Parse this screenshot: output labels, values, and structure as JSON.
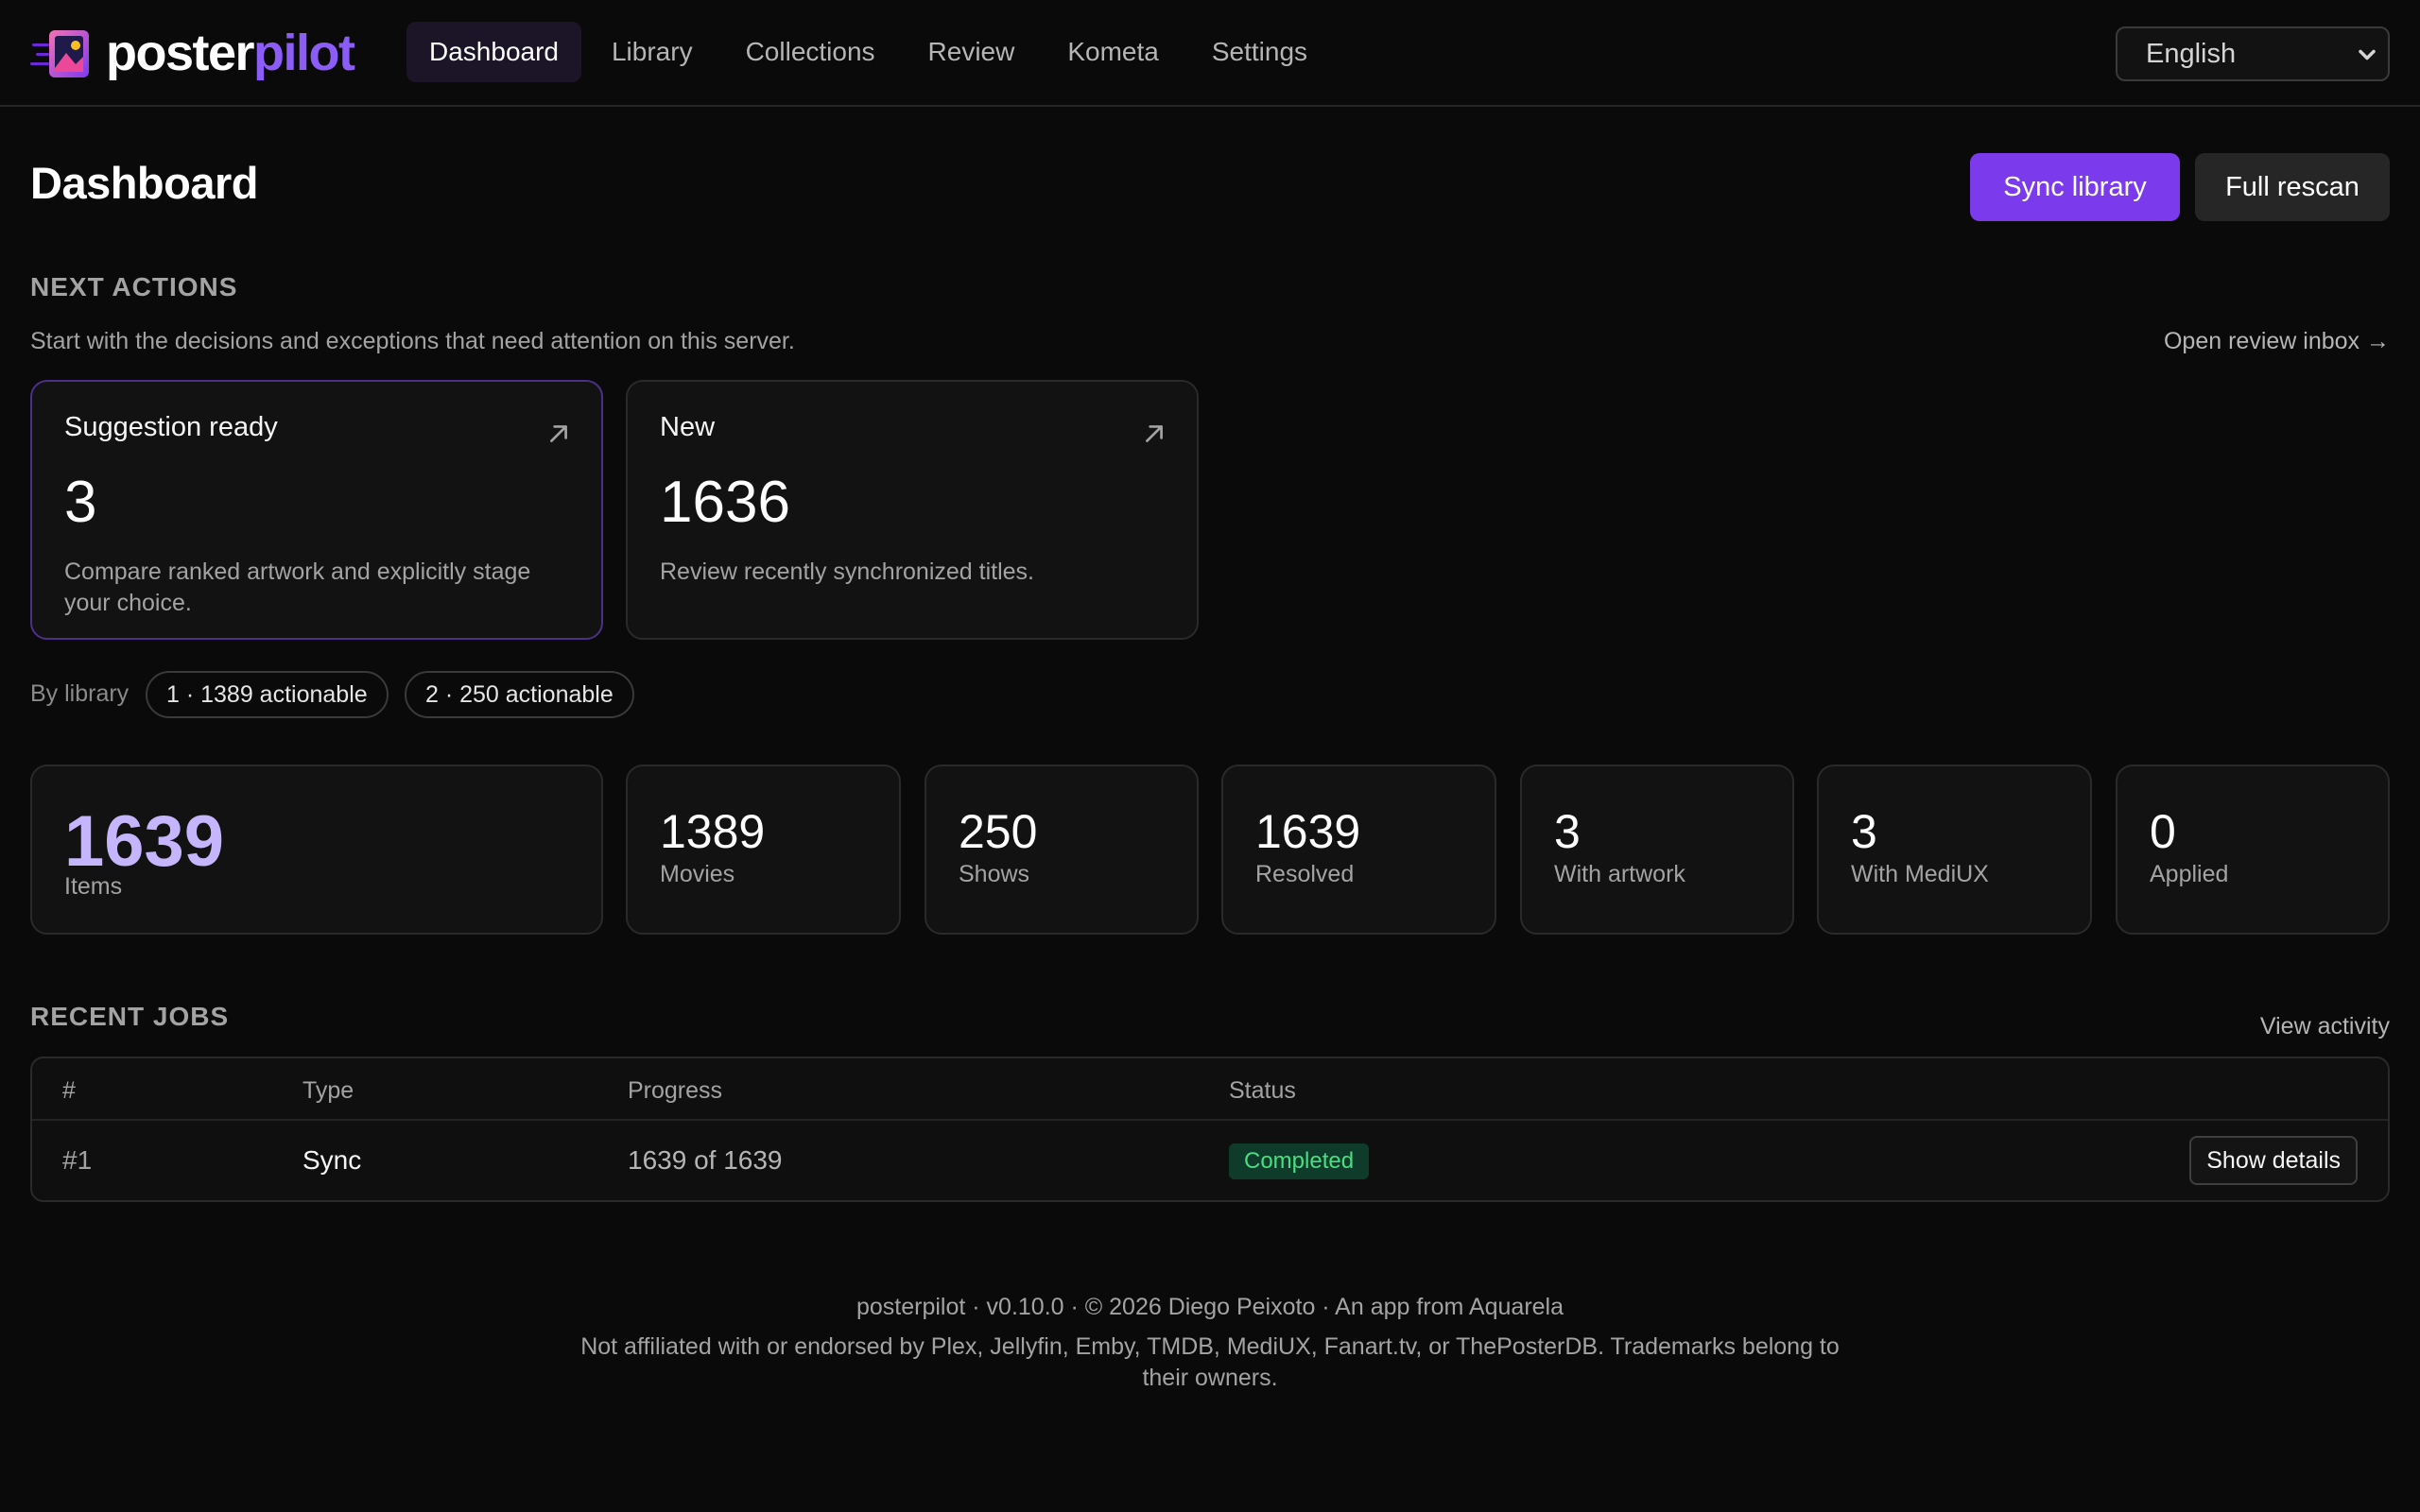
{
  "app": {
    "name_part1": "poster",
    "name_part2": "pilot"
  },
  "nav": {
    "items": [
      {
        "label": "Dashboard",
        "active": true
      },
      {
        "label": "Library"
      },
      {
        "label": "Collections"
      },
      {
        "label": "Review"
      },
      {
        "label": "Kometa"
      },
      {
        "label": "Settings"
      }
    ],
    "language": "English"
  },
  "header": {
    "title": "Dashboard",
    "sync_label": "Sync library",
    "rescan_label": "Full rescan"
  },
  "next_actions": {
    "heading": "NEXT ACTIONS",
    "subtext": "Start with the decisions and exceptions that need attention on this server.",
    "link": "Open review inbox →",
    "cards": [
      {
        "title": "Suggestion ready",
        "count": "3",
        "description": "Compare ranked artwork and explicitly stage your choice."
      },
      {
        "title": "New",
        "count": "1636",
        "description": "Review recently synchronized titles."
      }
    ]
  },
  "by_library": {
    "label": "By library",
    "chips": [
      "1 · 1389 actionable",
      "2 · 250 actionable"
    ]
  },
  "stats": [
    {
      "value": "1639",
      "label": "Items"
    },
    {
      "value": "1389",
      "label": "Movies"
    },
    {
      "value": "250",
      "label": "Shows"
    },
    {
      "value": "1639",
      "label": "Resolved"
    },
    {
      "value": "3",
      "label": "With artwork"
    },
    {
      "value": "3",
      "label": "With MediUX"
    },
    {
      "value": "0",
      "label": "Applied"
    }
  ],
  "recent_jobs": {
    "heading": "RECENT JOBS",
    "link": "View activity",
    "columns": [
      "#",
      "Type",
      "Progress",
      "Status"
    ],
    "rows": [
      {
        "id": "#1",
        "type": "Sync",
        "progress": "1639 of 1639",
        "status": "Completed",
        "action": "Show details"
      }
    ]
  },
  "footer": {
    "line1": "posterpilot · v0.10.0 · © 2026 Diego Peixoto · An app from Aquarela",
    "line2": "Not affiliated with or endorsed by Plex, Jellyfin, Emby, TMDB, MediUX, Fanart.tv, or ThePosterDB. Trademarks belong to their owners."
  },
  "colors": {
    "accent": "#7c3aed",
    "accent_light": "#c4b5fd",
    "success": "#4ade80",
    "background": "#0a0a0a"
  }
}
